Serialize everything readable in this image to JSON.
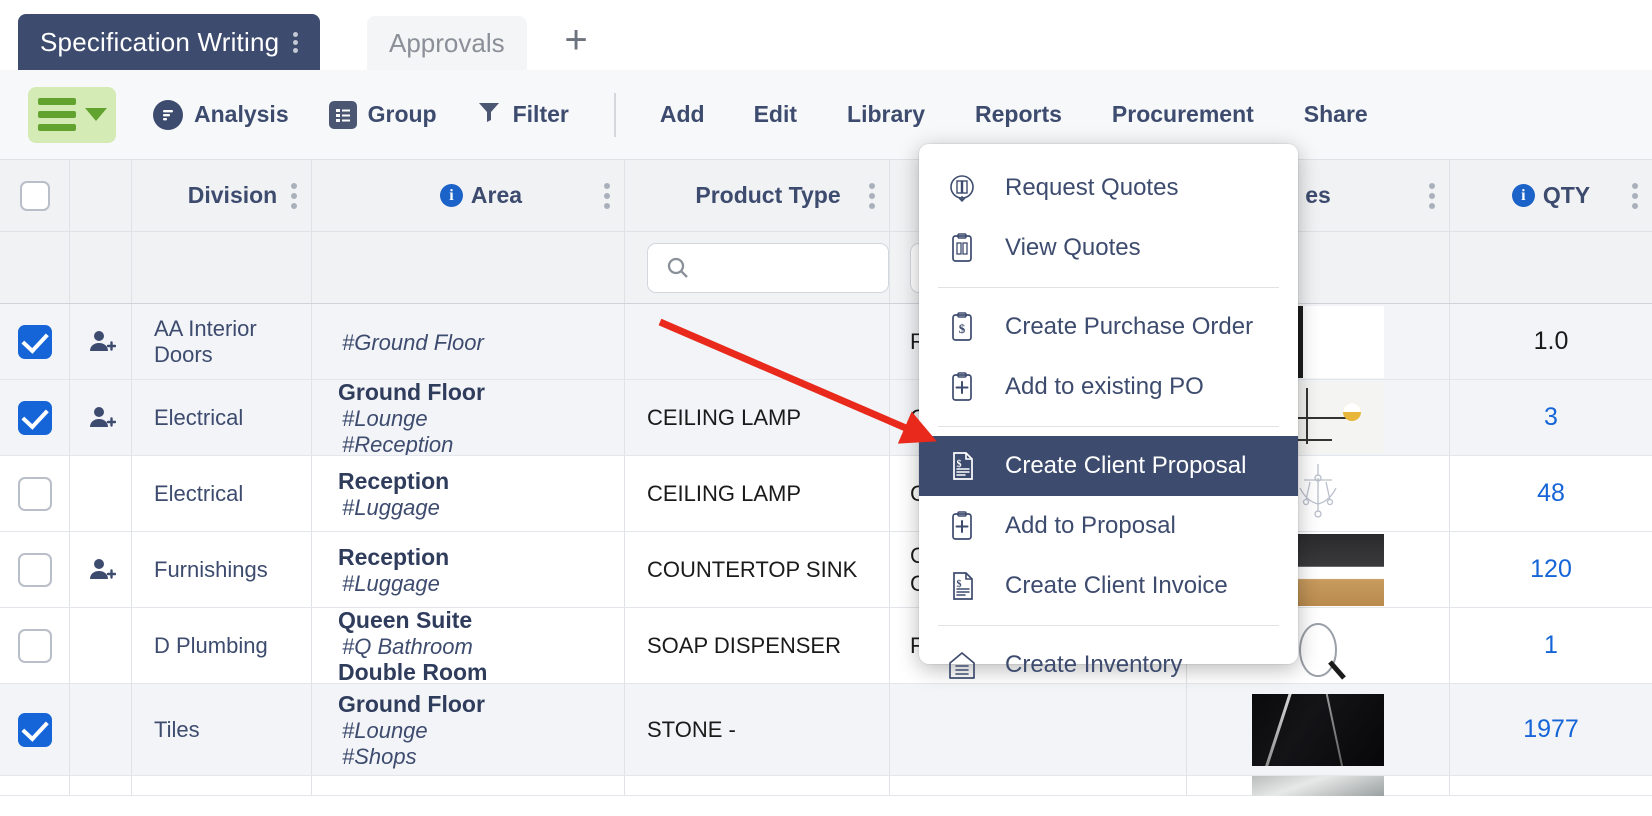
{
  "tabs": {
    "active": {
      "label": "Specification Writing",
      "kebab": "tab-options-icon"
    },
    "inactive": {
      "label": "Approvals"
    },
    "add_label": "+"
  },
  "toolbar": {
    "menu_button": "hamburger-menu-icon",
    "analysis": "Analysis",
    "group": "Group",
    "filter": "Filter",
    "add": "Add",
    "edit": "Edit",
    "library": "Library",
    "reports": "Reports",
    "procurement": "Procurement",
    "share": "Share"
  },
  "table": {
    "columns": [
      {
        "key": "select",
        "label": ""
      },
      {
        "key": "person",
        "label": ""
      },
      {
        "key": "division",
        "label": "Division",
        "info": false
      },
      {
        "key": "area",
        "label": "Area",
        "info": true
      },
      {
        "key": "product_type",
        "label": "Product Type",
        "info": false
      },
      {
        "key": "description",
        "label": "",
        "info": false
      },
      {
        "key": "images",
        "label": "es",
        "info": false
      },
      {
        "key": "qty",
        "label": "QTY",
        "info": true
      }
    ],
    "filter_placeholder": "",
    "rows": [
      {
        "checked": true,
        "person": true,
        "division": "AA Interior Doors",
        "area_title": "",
        "area_tags": [
          "#Ground Floor"
        ],
        "product_type": "",
        "description": "R",
        "image": "white-door-thumbnail",
        "qty": "1.0",
        "qty_blue": false
      },
      {
        "checked": true,
        "person": true,
        "division": "Electrical",
        "area_title": "Ground Floor",
        "area_tags": [
          "#Lounge",
          "#Reception"
        ],
        "product_type": "CEILING LAMP",
        "description": "C",
        "image": "ceiling-lamp-thumbnail",
        "qty": "3",
        "qty_blue": true
      },
      {
        "checked": false,
        "person": false,
        "division": "Electrical",
        "area_title": "Reception",
        "area_tags": [
          "#Luggage"
        ],
        "product_type": "CEILING LAMP",
        "description": "C",
        "image": "chandelier-thumbnail",
        "qty": "48",
        "qty_blue": true
      },
      {
        "checked": false,
        "person": true,
        "division": "Furnishings",
        "area_title": "Reception",
        "area_tags": [
          "#Luggage"
        ],
        "product_type": "COUNTERTOP SINK",
        "description": "G\nC",
        "image": "countertop-sink-thumbnail",
        "qty": "120",
        "qty_blue": true
      },
      {
        "checked": false,
        "person": false,
        "division": "D Plumbing",
        "area_title": "Queen Suite",
        "area_tags": [
          "#Q Bathroom",
          "Double Room"
        ],
        "product_type": "SOAP DISPENSER",
        "description": "FA",
        "image": "soap-dispenser-thumbnail",
        "qty": "1",
        "qty_blue": true
      },
      {
        "checked": true,
        "person": false,
        "division": "Tiles",
        "area_title": "Ground Floor",
        "area_tags": [
          "#Lounge",
          "#Shops"
        ],
        "product_type": "STONE -",
        "description": "",
        "image": "black-marble-thumbnail",
        "qty": "1977",
        "qty_blue": true
      }
    ]
  },
  "context_menu": {
    "items": [
      {
        "label": "Request Quotes",
        "icon": "request-quotes-icon",
        "active": false,
        "sep_after": false
      },
      {
        "label": "View Quotes",
        "icon": "view-quotes-icon",
        "active": false,
        "sep_after": true
      },
      {
        "label": "Create Purchase Order",
        "icon": "purchase-order-dollar-icon",
        "active": false,
        "sep_after": false
      },
      {
        "label": "Add to existing PO",
        "icon": "add-clipboard-icon",
        "active": false,
        "sep_after": true
      },
      {
        "label": "Create Client Proposal",
        "icon": "proposal-document-icon",
        "active": true,
        "sep_after": false
      },
      {
        "label": "Add to Proposal",
        "icon": "add-clipboard-icon",
        "active": false,
        "sep_after": false
      },
      {
        "label": "Create Client Invoice",
        "icon": "invoice-document-icon",
        "active": false,
        "sep_after": true
      },
      {
        "label": "Create Inventory",
        "icon": "inventory-home-icon",
        "active": false,
        "sep_after": false
      }
    ]
  },
  "colors": {
    "brand_navy": "#3d4b6e",
    "accent_blue": "#1565d8",
    "green_button": "#d5ebb5",
    "green_icon": "#62a32f",
    "annotation_red": "#e8291c"
  }
}
